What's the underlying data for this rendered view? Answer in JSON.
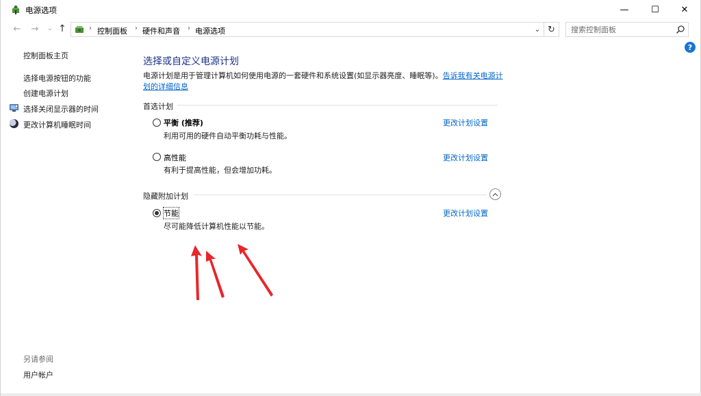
{
  "window": {
    "title": "电源选项",
    "minimize_glyph": "—",
    "maximize_glyph": "☐",
    "close_glyph": "✕"
  },
  "nav": {
    "back_glyph": "←",
    "forward_glyph": "→",
    "recent_glyph": "⌄",
    "up_glyph": "↑",
    "breadcrumbs": [
      "控制面板",
      "硬件和声音",
      "电源选项"
    ],
    "separator": "›",
    "dropdown_glyph": "⌄",
    "refresh_glyph": "↻"
  },
  "search": {
    "placeholder": "搜索控制面板",
    "value": ""
  },
  "help": {
    "glyph": "?"
  },
  "sidebar": {
    "home": "控制面板主页",
    "items": [
      {
        "label": "选择电源按钮的功能",
        "icon": "none"
      },
      {
        "label": "创建电源计划",
        "icon": "none"
      },
      {
        "label": "选择关闭显示器的时间",
        "icon": "monitor-icon"
      },
      {
        "label": "更改计算机睡眠时间",
        "icon": "moon-icon"
      }
    ],
    "see_also": "另请参阅",
    "see_also_items": [
      "用户帐户"
    ]
  },
  "main": {
    "title": "选择或自定义电源计划",
    "description": "电源计划是用于管理计算机如何使用电源的一套硬件和系统设置(如显示器亮度、睡眠等)。",
    "description_link_line1": "告诉我有关电源计",
    "description_link_line2": "划的详细信息",
    "preferred_section": "首选计划",
    "hidden_section": "隐藏附加计划",
    "plans": [
      {
        "name": "平衡 (推荐)",
        "desc": "利用可用的硬件自动平衡功耗与性能。",
        "link": "更改计划设置",
        "selected": false
      },
      {
        "name": "高性能",
        "desc": "有利于提高性能，但会增加功耗。",
        "link": "更改计划设置",
        "selected": false
      },
      {
        "name": "节能",
        "desc": "尽可能降低计算机性能以节能。",
        "link": "更改计划设置",
        "selected": true
      }
    ]
  },
  "colors": {
    "title_blue": "#1e3287",
    "link_blue": "#0066cc",
    "annotation_red": "#e8262b",
    "help_blue": "#1a74d1"
  }
}
